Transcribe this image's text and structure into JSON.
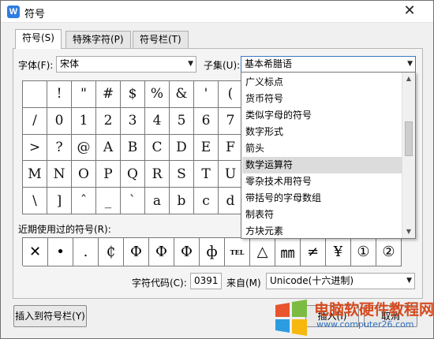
{
  "window": {
    "title": "符号",
    "icon": "wps-w-icon",
    "icon_letter": "W",
    "close": "✕"
  },
  "tabs": [
    {
      "label": "符号(S)",
      "active": true
    },
    {
      "label": "特殊字符(P)",
      "active": false
    },
    {
      "label": "符号栏(T)",
      "active": false
    }
  ],
  "font": {
    "label": "字体(F):",
    "value": "宋体"
  },
  "subset": {
    "label": "子集(U):",
    "value": "基本希腊语",
    "options": [
      "广义标点",
      "货币符号",
      "类似字母的符号",
      "数字形式",
      "箭头",
      "数学运算符",
      "零杂技术用符号",
      "带括号的字母数组",
      "制表符",
      "方块元素"
    ],
    "highlighted": "数学运算符"
  },
  "symbol_grid": [
    [
      "",
      "!",
      "\"",
      "#",
      "$",
      "%",
      "&",
      "'",
      "(",
      "",
      "",
      "",
      "",
      "",
      ""
    ],
    [
      "/",
      "0",
      "1",
      "2",
      "3",
      "4",
      "5",
      "6",
      "7",
      "",
      "",
      "",
      "",
      "",
      ""
    ],
    [
      ">",
      "?",
      "@",
      "A",
      "B",
      "C",
      "D",
      "E",
      "F",
      "",
      "",
      "",
      "",
      "",
      ""
    ],
    [
      "M",
      "N",
      "O",
      "P",
      "Q",
      "R",
      "S",
      "T",
      "U",
      "",
      "",
      "",
      "",
      "",
      ""
    ],
    [
      "\\",
      "]",
      "ˆ",
      "_",
      "`",
      "a",
      "b",
      "c",
      "d",
      "",
      "",
      "",
      "",
      "",
      ""
    ]
  ],
  "recent": {
    "label": "近期使用过的符号(R):",
    "symbols": [
      "✕",
      "•",
      ".",
      "₵",
      "Ф",
      "Ф",
      "Ф",
      "ф",
      "TEL",
      "△",
      "㎜",
      "≠",
      "¥",
      "①",
      "②"
    ]
  },
  "char_code": {
    "label": "字符代码(C):",
    "value": "0391"
  },
  "from": {
    "label": "来自(M)",
    "value": "Unicode(十六进制)"
  },
  "buttons": {
    "insert_to_bar": "插入到符号栏(Y)",
    "insert": "插入(I)",
    "cancel": "取消"
  },
  "watermark": {
    "site_name": "电脑软硬件教程网",
    "url": "www.computer26.com"
  },
  "colors": {
    "accent": "#3a78c4",
    "highlight": "#dcdcdc",
    "watermark": "#d64b1f"
  }
}
